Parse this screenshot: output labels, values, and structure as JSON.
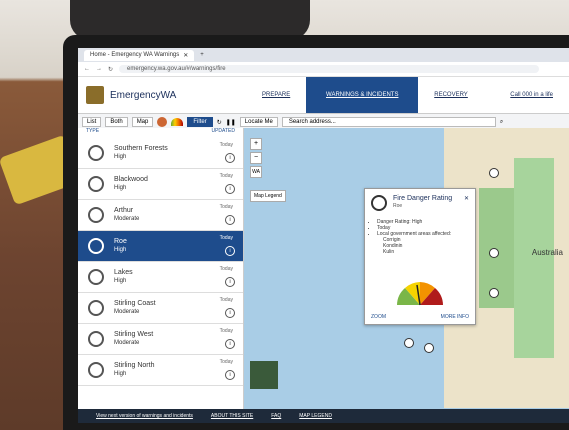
{
  "browser": {
    "tab_title": "Home - Emergency WA Warnings",
    "url": "emergency.wa.gov.au/#/warnings/fire"
  },
  "site": {
    "brand": "EmergencyWA",
    "nav": [
      "PREPARE",
      "WARNINGS & INCIDENTS",
      "RECOVERY"
    ],
    "call": "Call 000 in a life"
  },
  "toolbar": {
    "list": "List",
    "both": "Both",
    "map": "Map",
    "filter": "Filter",
    "locate": "Locate Me",
    "search_placeholder": "Search address..."
  },
  "list": {
    "col_type": "TYPE",
    "col_updated": "UPDATED",
    "items": [
      {
        "name": "Southern Forests",
        "level": "High",
        "day": "Today"
      },
      {
        "name": "Blackwood",
        "level": "High",
        "day": "Today"
      },
      {
        "name": "Arthur",
        "level": "Moderate",
        "day": "Today"
      },
      {
        "name": "Roe",
        "level": "High",
        "day": "Today"
      },
      {
        "name": "Lakes",
        "level": "High",
        "day": "Today"
      },
      {
        "name": "Stirling Coast",
        "level": "Moderate",
        "day": "Today"
      },
      {
        "name": "Stirling West",
        "level": "Moderate",
        "day": "Today"
      },
      {
        "name": "Stirling North",
        "level": "High",
        "day": "Today"
      }
    ]
  },
  "map": {
    "legend_button": "Map Legend",
    "label_australia": "Australia",
    "popup": {
      "title": "Fire Danger Rating",
      "subtitle": "Roe",
      "bullets": [
        "Danger Rating: High",
        "Today",
        "Local government areas affected:"
      ],
      "lgas": [
        "Corrigin",
        "Kondinin",
        "Kulin"
      ],
      "zoom": "ZOOM",
      "more": "MORE INFO"
    }
  },
  "footer": [
    "View next version of warnings and incidents",
    "ABOUT THIS SITE",
    "FAQ",
    "MAP LEGEND"
  ]
}
